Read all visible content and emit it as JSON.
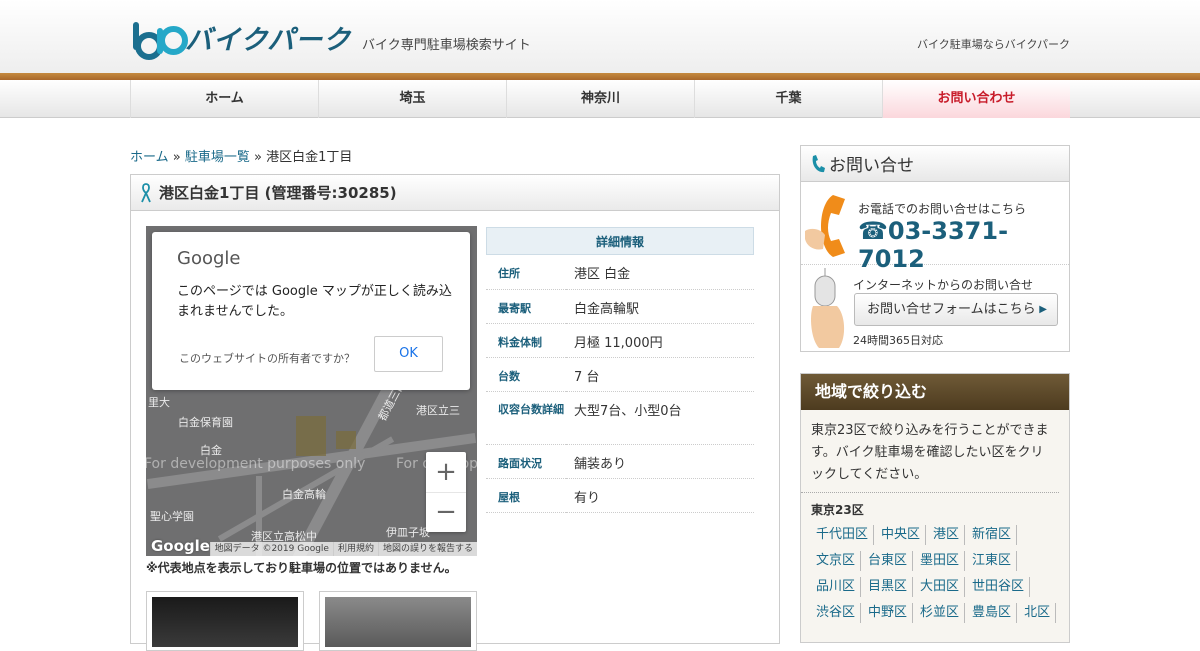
{
  "header": {
    "logo_text": "バイクパーク",
    "tagline": "バイク専門駐車場検索サイト",
    "right_text": "バイク駐車場ならバイクパーク"
  },
  "nav": {
    "items": [
      "ホーム",
      "埼玉",
      "神奈川",
      "千葉",
      "お問い合わせ"
    ]
  },
  "breadcrumb": {
    "home": "ホーム",
    "sep1": "»",
    "list": "駐車場一覧",
    "sep2": "»",
    "current": "港区白金1丁目"
  },
  "page": {
    "title": "港区白金1丁目 (管理番号:30285)"
  },
  "map": {
    "dialog_brand": "Google",
    "dialog_message": "このページでは Google マップが正しく読み込まれませんでした。",
    "dialog_owner": "このウェブサイトの所有者ですか？",
    "dialog_ok": "OK",
    "dev_text_1": "For development purposes only",
    "dev_text_2": "For development purposes only",
    "labels": [
      "里大",
      "白金保育園",
      "港区立三",
      "白金",
      "都道三田線",
      "白金高輪",
      "聖心学園",
      "港区立高松中",
      "伊皿子坂"
    ],
    "zoom_in": "+",
    "zoom_out": "−",
    "google_logo": "Google",
    "footer": [
      "地図データ ©2019 Google",
      "利用規約",
      "地図の誤りを報告する"
    ],
    "note": "※代表地点を表示しており駐車場の位置ではありません。"
  },
  "details": {
    "heading": "詳細情報",
    "rows": [
      {
        "key": "住所",
        "value": "港区 白金"
      },
      {
        "key": "最寄駅",
        "value": "白金高輪駅"
      },
      {
        "key": "料金体制",
        "value": "月極 11,000円"
      },
      {
        "key": "台数",
        "value": "7 台"
      },
      {
        "key": "収容台数詳細",
        "value": "大型7台、小型0台"
      },
      {
        "key": "路面状況",
        "value": "舗装あり"
      },
      {
        "key": "屋根",
        "value": "有り"
      }
    ]
  },
  "sidebar_contact": {
    "title": "お問い合せ",
    "phone_label": "お電話でのお問い合せはこちら",
    "phone_number": "03-3371-7012",
    "net_label": "インターネットからのお問い合せ",
    "form_button": "お問い合せフォームはこちら",
    "hours": "24時間365日対応"
  },
  "sidebar_region": {
    "title": "地域で絞り込む",
    "description": "東京23区で絞り込みを行うことができます。バイク駐車場を確認したい区をクリックしてください。",
    "subheading": "東京23区",
    "wards": [
      "千代田区",
      "中央区",
      "港区",
      "新宿区",
      "文京区",
      "台東区",
      "墨田区",
      "江東区",
      "品川区",
      "目黒区",
      "大田区",
      "世田谷区",
      "渋谷区",
      "中野区",
      "杉並区",
      "豊島区",
      "北区"
    ]
  },
  "colors": {
    "brand_blue": "#1b5f7b",
    "accent_cyan": "#25a8c8",
    "brown_bar": "#a9682a",
    "contact_red": "#c81c2a"
  }
}
